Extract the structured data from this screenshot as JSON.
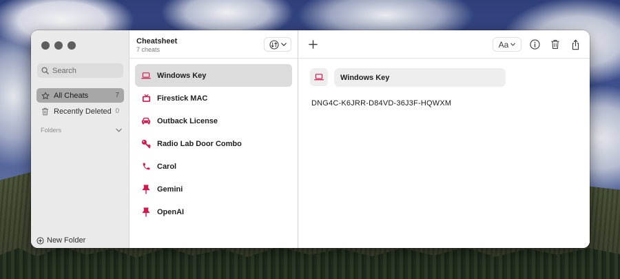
{
  "sidebar": {
    "search_placeholder": "Search",
    "items": [
      {
        "label": "All Cheats",
        "count": "7",
        "icon": "star-icon"
      },
      {
        "label": "Recently Deleted",
        "count": "0",
        "icon": "trash-icon"
      }
    ],
    "folders_label": "Folders",
    "new_folder_label": "New Folder"
  },
  "list": {
    "title": "Cheatsheet",
    "subtitle": "7 cheats",
    "items": [
      {
        "label": "Windows Key",
        "icon": "laptop-icon"
      },
      {
        "label": "Firestick MAC",
        "icon": "tv-icon"
      },
      {
        "label": "Outback License",
        "icon": "car-icon"
      },
      {
        "label": "Radio Lab Door Combo",
        "icon": "key-icon"
      },
      {
        "label": "Carol",
        "icon": "phone-icon"
      },
      {
        "label": "Gemini",
        "icon": "pin-icon"
      },
      {
        "label": "OpenAI",
        "icon": "pin-icon"
      }
    ]
  },
  "detail": {
    "title": "Windows Key",
    "body": "DNG4C-K6JRR-D84VD-36J3F-HQWXM",
    "font_button_label": "Aa"
  },
  "colors": {
    "accent": "#d4174d",
    "sidebar_bg": "#eaeaea",
    "selected_row": "#dcdcdc"
  }
}
